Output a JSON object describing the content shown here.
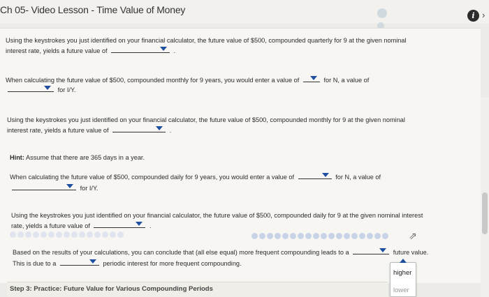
{
  "window": {
    "title": "Ch 05- Video Lesson - Time Value of Money"
  },
  "questions": {
    "q1": {
      "line1": "Using the keystrokes you just identified on your financial calculator, the future value of $500, compounded quarterly for 9 at the given nominal",
      "line2_pre": "interest rate, yields a future value of",
      "line2_post": "."
    },
    "q2": {
      "line1_pre": "When calculating the future value of $500, compounded monthly for 9 years, you would enter a value of",
      "line1_post": "for N, a value of",
      "line2_post": "for I/Y."
    },
    "q3": {
      "line1": "Using the keystrokes you just identified on your financial calculator, the future value of $500, compounded monthly for 9 at the given nominal",
      "line2_pre": "interest rate, yields a future value of",
      "line2_post": "."
    },
    "hint": {
      "label": "Hint:",
      "text": "Assume that there are 365 days in a year."
    },
    "q4": {
      "line1_pre": "When calculating the future value of $500, compounded daily for 9 years, you would enter a value of",
      "line1_post": "for N, a value of",
      "line2_post": "for I/Y."
    },
    "q5": {
      "line1": "Using the keystrokes you just identified on your financial calculator, the future value of $500, compounded daily for 9 at the given nominal interest",
      "line2_pre": "rate, yields a future value of",
      "line2_post": "."
    },
    "q6": {
      "line1_pre": "Based on the results of your calculations, you can conclude that (all else equal) more frequent compounding leads to a",
      "line1_post": "future value.",
      "line2_pre": "This is due to a",
      "line2_post": "periodic interest for more frequent compounding."
    }
  },
  "dropdown_open": {
    "options": [
      "higher",
      "lower"
    ]
  },
  "step": {
    "title": "Step 3: Practice: Future Value for Various Compounding Periods"
  },
  "colors": {
    "accent": "#1e4fa0",
    "background": "#f7f6f3"
  }
}
